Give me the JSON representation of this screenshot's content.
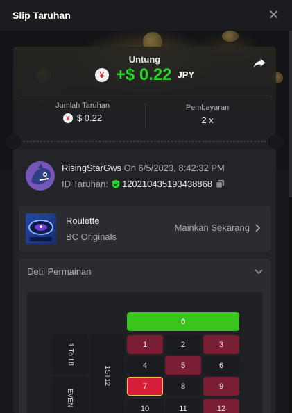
{
  "header": {
    "title": "Slip Taruhan",
    "close_icon": "close-icon"
  },
  "summary": {
    "profit_label": "Untung",
    "profit_amount": "+$ 0.22",
    "profit_currency": "JPY",
    "currency_icon": "yen-coin-icon",
    "bet_label": "Jumlah Taruhan",
    "bet_amount": "$ 0.22",
    "payout_label": "Pembayaran",
    "payout_value": "2 x"
  },
  "bet": {
    "username": "RisingStarGws",
    "on_text": "On 6/5/2023, 8:42:32 PM",
    "id_label": "ID Taruhan:",
    "id_value": "120210435193438868"
  },
  "game": {
    "name": "Roulette",
    "provider": "BC Originals",
    "play_label": "Mainkan Sekarang"
  },
  "details": {
    "title": "Detil Permainan"
  },
  "board": {
    "zero": "0",
    "side_labels": [
      "1 To 18",
      "EVEN",
      "1ST12"
    ],
    "rows": [
      [
        {
          "n": "1",
          "c": "red"
        },
        {
          "n": "2",
          "c": "black"
        },
        {
          "n": "3",
          "c": "red"
        }
      ],
      [
        {
          "n": "4",
          "c": "black"
        },
        {
          "n": "5",
          "c": "red"
        },
        {
          "n": "6",
          "c": "black"
        }
      ],
      [
        {
          "n": "7",
          "c": "selected"
        },
        {
          "n": "8",
          "c": "black"
        },
        {
          "n": "9",
          "c": "red"
        }
      ],
      [
        {
          "n": "10",
          "c": "black"
        },
        {
          "n": "11",
          "c": "black"
        },
        {
          "n": "12",
          "c": "red"
        }
      ]
    ]
  },
  "colors": {
    "profit_green": "#2bd42b",
    "zero_green": "#3bc41e",
    "red_cell": "#7a1f33",
    "selected_cell": "#d41e3a"
  }
}
